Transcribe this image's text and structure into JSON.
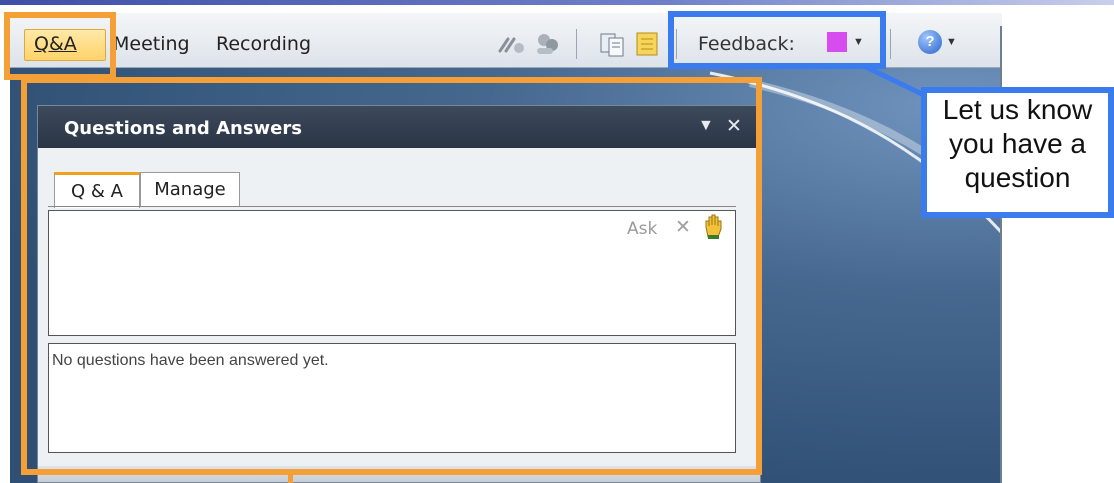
{
  "menu": {
    "qa_label": "Q&A",
    "meeting_label": "Meeting",
    "recording_label": "Recording"
  },
  "feedback": {
    "label": "Feedback:",
    "color": "#d64cef"
  },
  "help": {
    "icon_text": "?"
  },
  "panel": {
    "title": "Questions and Answers",
    "tabs": [
      {
        "label": "Q & A"
      },
      {
        "label": "Manage"
      }
    ],
    "ask_label": "Ask",
    "answers_placeholder": "No questions have been answered yet."
  },
  "callout": {
    "line1": "Let us know",
    "line2": "you have a",
    "line3": "question"
  },
  "colors": {
    "highlight_orange": "#f5a036",
    "highlight_blue": "#3a7bee",
    "panel_header": "#2a3545"
  }
}
